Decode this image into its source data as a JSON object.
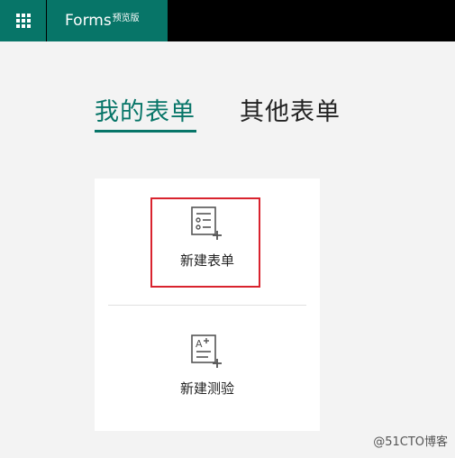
{
  "header": {
    "app_name": "Forms",
    "app_badge": "预览版",
    "app_launcher_icon": "waffle-icon"
  },
  "tabs": [
    {
      "label": "我的表单",
      "active": true
    },
    {
      "label": "其他表单",
      "active": false
    }
  ],
  "create_card": {
    "options": [
      {
        "label": "新建表单",
        "icon": "new-form-icon"
      },
      {
        "label": "新建测验",
        "icon": "new-quiz-icon"
      }
    ]
  },
  "watermark": "@51CTO博客",
  "colors": {
    "brand_teal": "#077568",
    "topbar": "#000000",
    "page_background": "#f3f3f3",
    "highlight_red": "#d9232e"
  }
}
